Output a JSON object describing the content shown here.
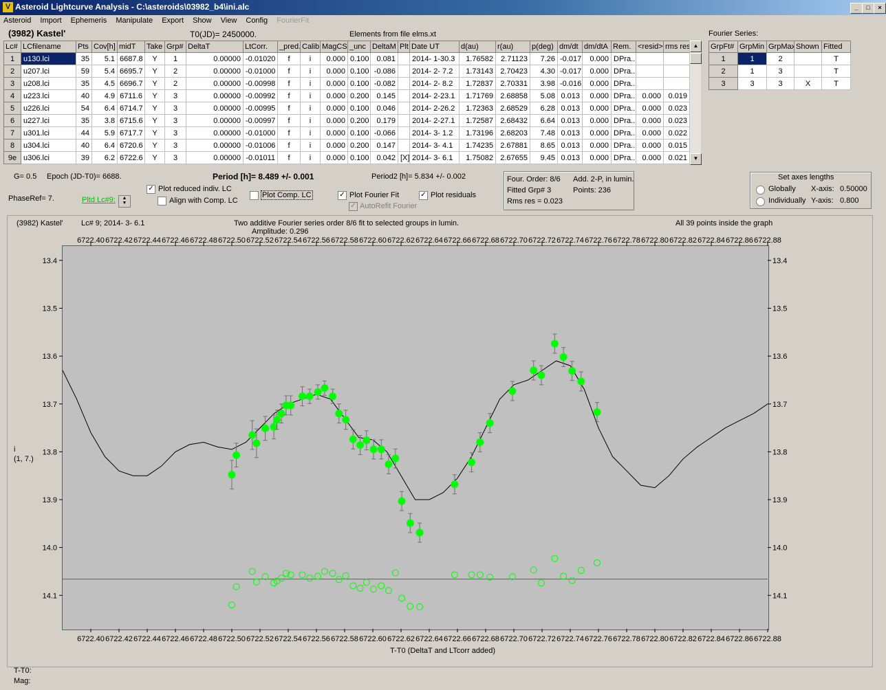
{
  "window": {
    "app_icon_text": "V",
    "title": "Asteroid Lightcurve Analysis - C:\\asteroids\\03982_b4\\ini.alc",
    "min": "_",
    "max": "□",
    "close": "×"
  },
  "menu": [
    "Asteroid",
    "Import",
    "Ephemeris",
    "Manipulate",
    "Export",
    "Show",
    "View",
    "Config"
  ],
  "menu_disabled": "FourierFit",
  "header": {
    "asteroid": "(3982) Kastel'",
    "t0": "T0(JD)= 2450000.",
    "elements": "Elements from file elms.xt",
    "fourier_series_label": "Fourier Series:"
  },
  "lc_table": {
    "columns": [
      "Lc#",
      "LCfilename",
      "Pts",
      "Cov[h]",
      "midT",
      "Take",
      "Grp#",
      "DeltaT",
      "LtCorr.",
      "_pred.",
      "Calib.",
      "MagCS",
      "_unc",
      "DeltaM",
      "Plt",
      "Date UT",
      "d(au)",
      "r(au)",
      "p(deg)",
      "dm/dt",
      "dm/dtA",
      "Rem.",
      "<resid>",
      "rms res"
    ],
    "rows": [
      [
        "1",
        "u130.lci",
        "35",
        "5.1",
        "6687.8",
        "Y",
        "1",
        "0.00000",
        "-0.01020",
        "f",
        "i",
        "0.000",
        "0.100",
        "0.081",
        "",
        "2014- 1-30.3",
        "1.76582",
        "2.71123",
        "7.26",
        "-0.017",
        "0.000",
        "DPra...",
        "",
        ""
      ],
      [
        "2",
        "u207.lci",
        "59",
        "5.4",
        "6695.7",
        "Y",
        "2",
        "0.00000",
        "-0.01000",
        "f",
        "i",
        "0.000",
        "0.100",
        "-0.086",
        "",
        "2014- 2- 7.2",
        "1.73143",
        "2.70423",
        "4.30",
        "-0.017",
        "0.000",
        "DPra...",
        "",
        ""
      ],
      [
        "3",
        "u208.lci",
        "35",
        "4.5",
        "6696.7",
        "Y",
        "2",
        "0.00000",
        "-0.00998",
        "f",
        "i",
        "0.000",
        "0.100",
        "-0.082",
        "",
        "2014- 2- 8.2",
        "1.72837",
        "2.70331",
        "3.98",
        "-0.016",
        "0.000",
        "DPra...",
        "",
        ""
      ],
      [
        "4",
        "u223.lci",
        "40",
        "4.9",
        "6711.6",
        "Y",
        "3",
        "0.00000",
        "-0.00992",
        "f",
        "i",
        "0.000",
        "0.200",
        "0.145",
        "",
        "2014- 2-23.1",
        "1.71769",
        "2.68858",
        "5.08",
        "0.013",
        "0.000",
        "DPra...",
        "0.000",
        "0.019"
      ],
      [
        "5",
        "u226.lci",
        "54",
        "6.4",
        "6714.7",
        "Y",
        "3",
        "0.00000",
        "-0.00995",
        "f",
        "i",
        "0.000",
        "0.100",
        "0.046",
        "",
        "2014- 2-26.2",
        "1.72363",
        "2.68529",
        "6.28",
        "0.013",
        "0.000",
        "DPra...",
        "0.000",
        "0.023"
      ],
      [
        "6",
        "u227.lci",
        "35",
        "3.8",
        "6715.6",
        "Y",
        "3",
        "0.00000",
        "-0.00997",
        "f",
        "i",
        "0.000",
        "0.200",
        "0.179",
        "",
        "2014- 2-27.1",
        "1.72587",
        "2.68432",
        "6.64",
        "0.013",
        "0.000",
        "DPra...",
        "0.000",
        "0.023"
      ],
      [
        "7",
        "u301.lci",
        "44",
        "5.9",
        "6717.7",
        "Y",
        "3",
        "0.00000",
        "-0.01000",
        "f",
        "i",
        "0.000",
        "0.100",
        "-0.066",
        "",
        "2014- 3- 1.2",
        "1.73196",
        "2.68203",
        "7.48",
        "0.013",
        "0.000",
        "DPra...",
        "0.000",
        "0.022"
      ],
      [
        "8",
        "u304.lci",
        "40",
        "6.4",
        "6720.6",
        "Y",
        "3",
        "0.00000",
        "-0.01006",
        "f",
        "i",
        "0.000",
        "0.200",
        "0.147",
        "",
        "2014- 3- 4.1",
        "1.74235",
        "2.67881",
        "8.65",
        "0.013",
        "0.000",
        "DPra...",
        "0.000",
        "0.015"
      ],
      [
        "9e",
        "u306.lci",
        "39",
        "6.2",
        "6722.6",
        "Y",
        "3",
        "0.00000",
        "-0.01011",
        "f",
        "i",
        "0.000",
        "0.100",
        "0.042",
        "[X]",
        "2014- 3- 6.1",
        "1.75082",
        "2.67655",
        "9.45",
        "0.013",
        "0.000",
        "DPra...",
        "0.000",
        "0.021"
      ]
    ]
  },
  "fourier_table": {
    "columns": [
      "GrpFt#",
      "GrpMin",
      "GrpMax",
      "Shown",
      "Fitted"
    ],
    "rows": [
      [
        "1",
        "1",
        "2",
        "",
        "T"
      ],
      [
        "2",
        "1",
        "3",
        "",
        "T"
      ],
      [
        "3",
        "3",
        "3",
        "X",
        "T"
      ]
    ]
  },
  "controls": {
    "g": "G= 0.5",
    "epoch": "Epoch (JD-T0)= 6688.",
    "period": "Period [h]= 8.489 +/- 0.001",
    "period2": "Period2 [h]= 5.834 +/- 0.002",
    "phaseref": "PhaseRef= 7.",
    "plot_reduced": "Plot reduced indiv. LC",
    "align_comp": "Align with Comp. LC",
    "plot_comp": "Plot Comp. LC",
    "plot_fourier": "Plot Fourier Fit",
    "plot_residuals": "Plot residuals",
    "autorefit": "AutoRefit Fourier",
    "pltd_lc": "Pltd Lc#9:",
    "fourier_info": {
      "order": "Four. Order:  8/6",
      "add": "Add. 2-P, in lumin.",
      "fitted": "Fitted Grp# 3",
      "points": "Points: 236",
      "rms": "Rms res     = 0.023"
    },
    "axes": {
      "title": "Set axes lengths",
      "globally": "Globally",
      "individually": "Individually",
      "xaxis_label": "X-axis:",
      "xaxis_value": "0.50000",
      "yaxis_label": "Y-axis:",
      "yaxis_value": "0.800"
    },
    "checked": {
      "plot_reduced": true,
      "align_comp": false,
      "plot_comp": false,
      "plot_fourier": true,
      "plot_residuals": true,
      "autorefit": true
    }
  },
  "plot": {
    "left_title": "(3982) Kastel'",
    "lc_info": "Lc# 9; 2014- 3- 6.1",
    "caption": "Two additive Fourier series order 8/6 fit to selected groups in lumin.",
    "amplitude": "Amplitude: 0.296",
    "points_inside": "All 39 points inside the graph",
    "ylabel_line1": "i",
    "ylabel_line2": "(1, 7.)",
    "xlabel": "T-T0 (DeltaT and LTcorr added)"
  },
  "status": {
    "t_t0": "T-T0:",
    "mag": "Mag:"
  },
  "colors": {
    "point": "#00ff00",
    "background": "#c0c0c0",
    "titlebar": "#0a246a"
  },
  "chart_data": {
    "type": "scatter",
    "xlim": [
      6722.38,
      6722.88
    ],
    "ylim": [
      14.17,
      13.37
    ],
    "x_ticks": [
      6722.4,
      6722.42,
      6722.44,
      6722.46,
      6722.48,
      6722.5,
      6722.52,
      6722.54,
      6722.56,
      6722.58,
      6722.6,
      6722.62,
      6722.64,
      6722.66,
      6722.68,
      6722.7,
      6722.72,
      6722.74,
      6722.76,
      6722.78,
      6722.8,
      6722.82,
      6722.84,
      6722.86,
      6722.88
    ],
    "x_tick_labels": [
      "6722.40",
      "6722.42",
      "6722.44",
      "6722.46",
      "6722.48",
      "6722.50",
      "6722.52",
      "6722.54",
      "6722.56",
      "6722.58",
      "6722.60",
      "6722.62",
      "6722.64",
      "6722.66",
      "6722.68",
      "6722.70",
      "6722.72",
      "6722.74",
      "6722.76",
      "6722.78",
      "6722.80",
      "6722.82",
      "6722.84",
      "6722.86",
      "6722.88"
    ],
    "y_ticks": [
      13.4,
      13.5,
      13.6,
      13.7,
      13.8,
      13.9,
      14.0,
      14.1
    ],
    "y_tick_labels": [
      "13.4",
      "13.5",
      "13.6",
      "13.7",
      "13.8",
      "13.9",
      "14.0",
      "14.1"
    ],
    "residual_baseline": 14.066,
    "points": [
      {
        "x": 6722.5,
        "y": 13.848,
        "err": 0.03,
        "res": 14.12
      },
      {
        "x": 6722.5032,
        "y": 13.807,
        "err": 0.025,
        "res": 14.082
      },
      {
        "x": 6722.5145,
        "y": 13.765,
        "err": 0.03,
        "res": 14.05
      },
      {
        "x": 6722.5175,
        "y": 13.782,
        "err": 0.03,
        "res": 14.072
      },
      {
        "x": 6722.5237,
        "y": 13.751,
        "err": 0.025,
        "res": 14.061
      },
      {
        "x": 6722.5298,
        "y": 13.748,
        "err": 0.025,
        "res": 14.074
      },
      {
        "x": 6722.532,
        "y": 13.733,
        "err": 0.02,
        "res": 14.07
      },
      {
        "x": 6722.5352,
        "y": 13.72,
        "err": 0.02,
        "res": 14.064
      },
      {
        "x": 6722.5385,
        "y": 13.703,
        "err": 0.02,
        "res": 14.054
      },
      {
        "x": 6722.5418,
        "y": 13.703,
        "err": 0.02,
        "res": 14.057
      },
      {
        "x": 6722.55,
        "y": 13.684,
        "err": 0.02,
        "res": 14.057
      },
      {
        "x": 6722.5552,
        "y": 13.684,
        "err": 0.015,
        "res": 14.064
      },
      {
        "x": 6722.561,
        "y": 13.675,
        "err": 0.015,
        "res": 14.06
      },
      {
        "x": 6722.5658,
        "y": 13.667,
        "err": 0.015,
        "res": 14.05
      },
      {
        "x": 6722.5715,
        "y": 13.684,
        "err": 0.015,
        "res": 14.054
      },
      {
        "x": 6722.576,
        "y": 13.72,
        "err": 0.02,
        "res": 14.067
      },
      {
        "x": 6722.5808,
        "y": 13.733,
        "err": 0.02,
        "res": 14.059
      },
      {
        "x": 6722.586,
        "y": 13.774,
        "err": 0.02,
        "res": 14.08
      },
      {
        "x": 6722.591,
        "y": 13.786,
        "err": 0.02,
        "res": 14.085
      },
      {
        "x": 6722.5955,
        "y": 13.776,
        "err": 0.02,
        "res": 14.073
      },
      {
        "x": 6722.6005,
        "y": 13.795,
        "err": 0.02,
        "res": 14.087
      },
      {
        "x": 6722.606,
        "y": 13.795,
        "err": 0.02,
        "res": 14.08
      },
      {
        "x": 6722.6112,
        "y": 13.826,
        "err": 0.02,
        "res": 14.09
      },
      {
        "x": 6722.616,
        "y": 13.814,
        "err": 0.02,
        "res": 14.053
      },
      {
        "x": 6722.6205,
        "y": 13.903,
        "err": 0.02,
        "res": 14.106
      },
      {
        "x": 6722.6265,
        "y": 13.949,
        "err": 0.02,
        "res": 14.123
      },
      {
        "x": 6722.6332,
        "y": 13.969,
        "err": 0.02,
        "res": 14.124
      },
      {
        "x": 6722.658,
        "y": 13.868,
        "err": 0.02,
        "res": 14.057
      },
      {
        "x": 6722.67,
        "y": 13.822,
        "err": 0.02,
        "res": 14.057
      },
      {
        "x": 6722.676,
        "y": 13.78,
        "err": 0.02,
        "res": 14.057
      },
      {
        "x": 6722.683,
        "y": 13.74,
        "err": 0.02,
        "res": 14.062
      },
      {
        "x": 6722.699,
        "y": 13.673,
        "err": 0.02,
        "res": 14.061
      },
      {
        "x": 6722.714,
        "y": 13.63,
        "err": 0.02,
        "res": 14.047
      },
      {
        "x": 6722.7195,
        "y": 13.64,
        "err": 0.02,
        "res": 14.074
      },
      {
        "x": 6722.729,
        "y": 13.574,
        "err": 0.02,
        "res": 14.023
      },
      {
        "x": 6722.7352,
        "y": 13.602,
        "err": 0.02,
        "res": 14.06
      },
      {
        "x": 6722.7413,
        "y": 13.631,
        "err": 0.02,
        "res": 14.069
      },
      {
        "x": 6722.7477,
        "y": 13.653,
        "err": 0.02,
        "res": 14.048
      },
      {
        "x": 6722.759,
        "y": 13.717,
        "err": 0.02,
        "res": 14.032
      }
    ],
    "fit_curve": [
      [
        6722.38,
        13.63
      ],
      [
        6722.39,
        13.69
      ],
      [
        6722.4,
        13.76
      ],
      [
        6722.41,
        13.81
      ],
      [
        6722.42,
        13.84
      ],
      [
        6722.43,
        13.85
      ],
      [
        6722.44,
        13.85
      ],
      [
        6722.45,
        13.83
      ],
      [
        6722.46,
        13.8
      ],
      [
        6722.47,
        13.785
      ],
      [
        6722.48,
        13.78
      ],
      [
        6722.49,
        13.79
      ],
      [
        6722.5,
        13.795
      ],
      [
        6722.51,
        13.78
      ],
      [
        6722.52,
        13.75
      ],
      [
        6722.53,
        13.72
      ],
      [
        6722.54,
        13.7
      ],
      [
        6722.55,
        13.69
      ],
      [
        6722.56,
        13.68
      ],
      [
        6722.57,
        13.69
      ],
      [
        6722.58,
        13.73
      ],
      [
        6722.59,
        13.77
      ],
      [
        6722.6,
        13.775
      ],
      [
        6722.61,
        13.8
      ],
      [
        6722.62,
        13.85
      ],
      [
        6722.63,
        13.9
      ],
      [
        6722.64,
        13.9
      ],
      [
        6722.65,
        13.885
      ],
      [
        6722.66,
        13.855
      ],
      [
        6722.67,
        13.81
      ],
      [
        6722.68,
        13.75
      ],
      [
        6722.69,
        13.69
      ],
      [
        6722.7,
        13.66
      ],
      [
        6722.71,
        13.65
      ],
      [
        6722.72,
        13.63
      ],
      [
        6722.73,
        13.61
      ],
      [
        6722.74,
        13.62
      ],
      [
        6722.75,
        13.67
      ],
      [
        6722.76,
        13.75
      ],
      [
        6722.77,
        13.81
      ],
      [
        6722.78,
        13.84
      ],
      [
        6722.79,
        13.87
      ],
      [
        6722.8,
        13.875
      ],
      [
        6722.81,
        13.85
      ],
      [
        6722.82,
        13.815
      ],
      [
        6722.83,
        13.79
      ],
      [
        6722.84,
        13.77
      ],
      [
        6722.85,
        13.75
      ],
      [
        6722.86,
        13.735
      ],
      [
        6722.87,
        13.72
      ],
      [
        6722.88,
        13.7
      ]
    ]
  }
}
